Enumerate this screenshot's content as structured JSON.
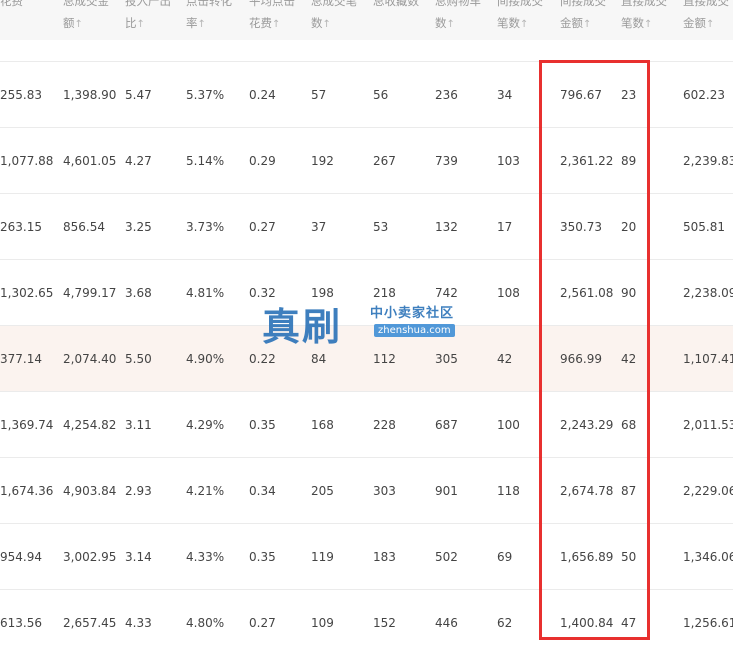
{
  "headers": [
    {
      "lines": [
        "花费"
      ],
      "arrow": "↑"
    },
    {
      "lines": [
        "总成交金",
        "额"
      ],
      "arrow": "↑"
    },
    {
      "lines": [
        "投入产出",
        "比"
      ],
      "arrow": "↑"
    },
    {
      "lines": [
        "点击转化",
        "率"
      ],
      "arrow": "↑"
    },
    {
      "lines": [
        "平均点击",
        "花费"
      ],
      "arrow": "↑"
    },
    {
      "lines": [
        "总成交笔",
        "数"
      ],
      "arrow": "↑"
    },
    {
      "lines": [
        "总收藏数",
        ""
      ],
      "arrow": "↑"
    },
    {
      "lines": [
        "总购物车",
        "数"
      ],
      "arrow": "↑"
    },
    {
      "lines": [
        "间接成交",
        "笔数"
      ],
      "arrow": "↑"
    },
    {
      "lines": [
        "间接成交",
        "金额"
      ],
      "arrow": "↑"
    },
    {
      "lines": [
        "直接成交",
        "笔数"
      ],
      "arrow": "↑"
    },
    {
      "lines": [
        "直接成交",
        "金额"
      ],
      "arrow": "↑"
    }
  ],
  "rows": [
    [
      "255.83",
      "1,398.90",
      "5.47",
      "5.37%",
      "0.24",
      "57",
      "56",
      "236",
      "34",
      "796.67",
      "23",
      "602.23"
    ],
    [
      "1,077.88",
      "4,601.05",
      "4.27",
      "5.14%",
      "0.29",
      "192",
      "267",
      "739",
      "103",
      "2,361.22",
      "89",
      "2,239.83"
    ],
    [
      "263.15",
      "856.54",
      "3.25",
      "3.73%",
      "0.27",
      "37",
      "53",
      "132",
      "17",
      "350.73",
      "20",
      "505.81"
    ],
    [
      "1,302.65",
      "4,799.17",
      "3.68",
      "4.81%",
      "0.32",
      "198",
      "218",
      "742",
      "108",
      "2,561.08",
      "90",
      "2,238.09"
    ],
    [
      "377.14",
      "2,074.40",
      "5.50",
      "4.90%",
      "0.22",
      "84",
      "112",
      "305",
      "42",
      "966.99",
      "42",
      "1,107.41"
    ],
    [
      "1,369.74",
      "4,254.82",
      "3.11",
      "4.29%",
      "0.35",
      "168",
      "228",
      "687",
      "100",
      "2,243.29",
      "68",
      "2,011.53"
    ],
    [
      "1,674.36",
      "4,903.84",
      "2.93",
      "4.21%",
      "0.34",
      "205",
      "303",
      "901",
      "118",
      "2,674.78",
      "87",
      "2,229.06"
    ],
    [
      "954.94",
      "3,002.95",
      "3.14",
      "4.33%",
      "0.35",
      "119",
      "183",
      "502",
      "69",
      "1,656.89",
      "50",
      "1,346.06"
    ],
    [
      "613.56",
      "2,657.45",
      "4.33",
      "4.80%",
      "0.27",
      "109",
      "152",
      "446",
      "62",
      "1,400.84",
      "47",
      "1,256.61"
    ]
  ],
  "highlight_row": 4,
  "watermark": {
    "big": "真刷",
    "small": "中小卖家社区",
    "url": "zhenshua.com"
  },
  "colors": {
    "highlight_box": "#e8302f",
    "watermark": "#2a72b8",
    "highlight_row_bg": "#fbf3ef"
  }
}
